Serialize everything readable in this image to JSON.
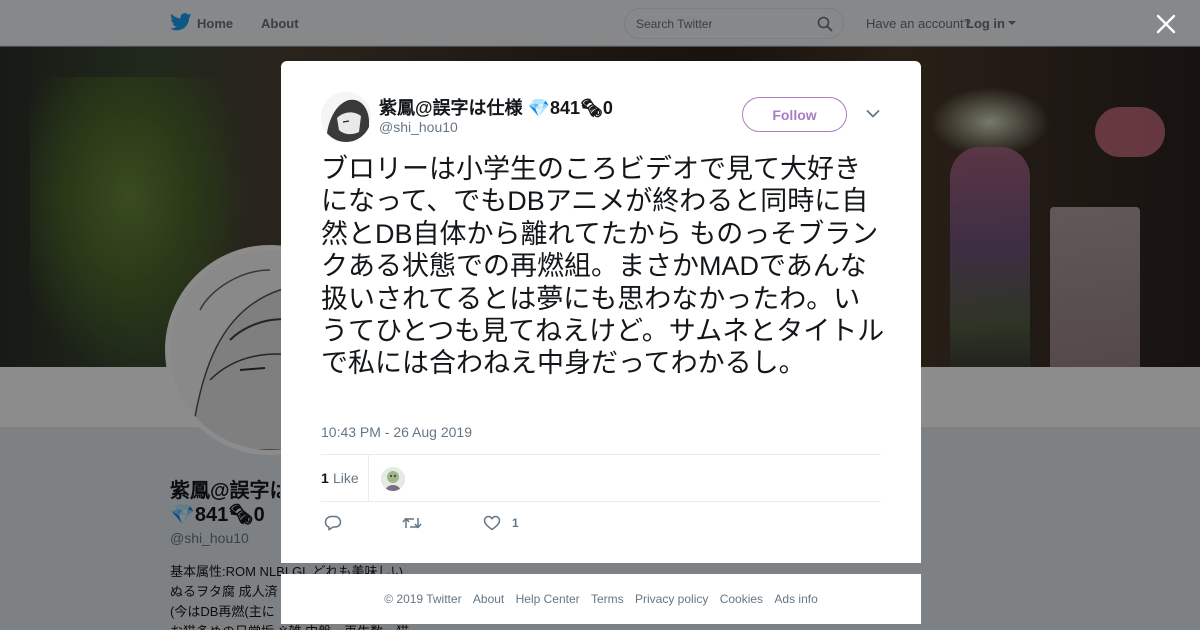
{
  "nav": {
    "home_label": "Home",
    "about_label": "About",
    "search_placeholder": "Search Twitter",
    "have_account": "Have an account?",
    "login_label": "Log in"
  },
  "profile": {
    "name_line1": "紫鳳@誤字は",
    "name_line2": "💎841🗞0",
    "handle": "@shi_hou10",
    "bio": [
      "基本属性:ROM NLBLGL どれも美味しい",
      "ぬるヲタ腐 成人済",
      "(今はDB再燃(主に",
      "お猫多めの日常垢 ※雑 中盤・再生数・猫"
    ]
  },
  "tweet": {
    "display_name": "紫鳳@誤字は仕様 💎841🗞0",
    "handle": "@shi_hou10",
    "follow_label": "Follow",
    "text": "ブロリーは小学生のころビデオで見て大好きになって、でもDBアニメが終わると同時に自然とDB自体から離れてたから ものっそブランクある状態での再燃組。まさかMADであんな扱いされてるとは夢にも思わなかったわ。いうてひとつも見てねえけど。サムネとタイトルで私には合わねえ中身だってわかるし。",
    "timestamp": "10:43 PM - 26 Aug 2019",
    "like_count": "1",
    "like_label": "Like",
    "action_like_count": "1"
  },
  "footer": {
    "copyright": "© 2019 Twitter",
    "links": [
      "About",
      "Help Center",
      "Terms",
      "Privacy policy",
      "Cookies",
      "Ads info"
    ]
  },
  "colors": {
    "twitter_blue": "#1da1f2",
    "follow_accent": "#ab7cc2",
    "muted_text": "#657786"
  }
}
